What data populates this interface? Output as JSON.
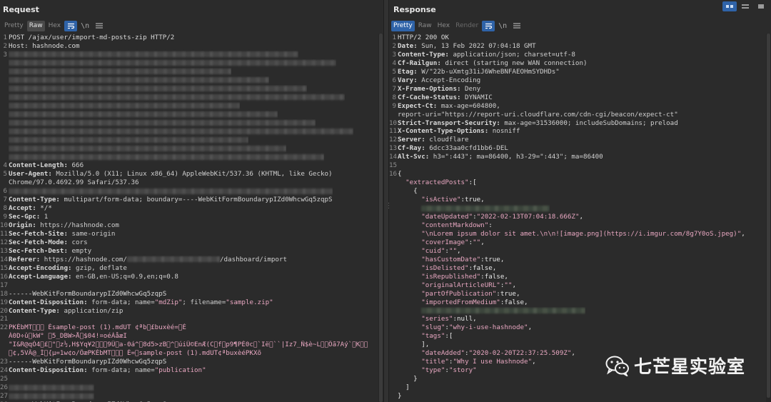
{
  "request": {
    "title": "Request",
    "tabs": [
      "Pretty",
      "Raw",
      "Hex"
    ],
    "active_tab": "Raw",
    "icons": [
      "wrap-icon",
      "newline-icon",
      "menu-icon"
    ],
    "lines": [
      {
        "n": "1",
        "parts": [
          {
            "t": "POST /ajax/user/import-md-posts-zip HTTP/2",
            "c": "txt"
          }
        ]
      },
      {
        "n": "2",
        "parts": [
          {
            "t": "Host: hashnode.com",
            "c": "txt"
          }
        ]
      },
      {
        "n": "3",
        "blur": true
      },
      {
        "n": "",
        "blur": true
      },
      {
        "n": "",
        "blur": true
      },
      {
        "n": "",
        "blur": true
      },
      {
        "n": "",
        "blur": true
      },
      {
        "n": "",
        "blur": true
      },
      {
        "n": "",
        "blur": true
      },
      {
        "n": "",
        "blur": true
      },
      {
        "n": "",
        "blur": true
      },
      {
        "n": "",
        "blur": true
      },
      {
        "n": "",
        "blur": true
      },
      {
        "n": "",
        "blur": true
      },
      {
        "n": "",
        "blur": true
      },
      {
        "n": "4",
        "parts": [
          {
            "t": "Content-Length: ",
            "c": "hkey"
          },
          {
            "t": "666",
            "c": "hval"
          }
        ]
      },
      {
        "n": "5",
        "parts": [
          {
            "t": "User-Agent: ",
            "c": "hkey"
          },
          {
            "t": "Mozilla/5.0 (X11; Linux x86_64) AppleWebKit/537.36 (KHTML, like Gecko)",
            "c": "hval"
          }
        ]
      },
      {
        "n": "",
        "parts": [
          {
            "t": "Chrome/97.0.4692.99 Safari/537.36",
            "c": "hval"
          }
        ]
      },
      {
        "n": "6",
        "blur": true
      },
      {
        "n": "7",
        "parts": [
          {
            "t": "Content-Type: ",
            "c": "hkey"
          },
          {
            "t": "multipart/form-data; boundary=----WebKitFormBoundarypIZd0WhcwGq5zqpS",
            "c": "hval"
          }
        ]
      },
      {
        "n": "8",
        "parts": [
          {
            "t": "Accept: ",
            "c": "hkey"
          },
          {
            "t": "*/*",
            "c": "hval"
          }
        ]
      },
      {
        "n": "9",
        "parts": [
          {
            "t": "Sec-Gpc: ",
            "c": "hkey"
          },
          {
            "t": "1",
            "c": "hval"
          }
        ]
      },
      {
        "n": "10",
        "parts": [
          {
            "t": "Origin: ",
            "c": "hkey"
          },
          {
            "t": "https://hashnode.com",
            "c": "hval"
          }
        ]
      },
      {
        "n": "11",
        "parts": [
          {
            "t": "Sec-Fetch-Site: ",
            "c": "hkey"
          },
          {
            "t": "same-origin",
            "c": "hval"
          }
        ]
      },
      {
        "n": "12",
        "parts": [
          {
            "t": "Sec-Fetch-Mode: ",
            "c": "hkey"
          },
          {
            "t": "cors",
            "c": "hval"
          }
        ]
      },
      {
        "n": "13",
        "parts": [
          {
            "t": "Sec-Fetch-Dest: ",
            "c": "hkey"
          },
          {
            "t": "empty",
            "c": "hval"
          }
        ]
      },
      {
        "n": "14",
        "parts": [
          {
            "t": "Referer: ",
            "c": "hkey"
          },
          {
            "t": "https://hashnode.com/",
            "c": "hval"
          },
          {
            "blur": true
          },
          {
            "t": "/dashboard/import",
            "c": "hval"
          }
        ]
      },
      {
        "n": "15",
        "parts": [
          {
            "t": "Accept-Encoding: ",
            "c": "hkey"
          },
          {
            "t": "gzip, deflate",
            "c": "hval"
          }
        ]
      },
      {
        "n": "16",
        "parts": [
          {
            "t": "Accept-Language: ",
            "c": "hkey"
          },
          {
            "t": "en-GB,en-US;q=0.9,en;q=0.8",
            "c": "hval"
          }
        ]
      },
      {
        "n": "17",
        "parts": [
          {
            "t": "",
            "c": "txt"
          }
        ]
      },
      {
        "n": "18",
        "parts": [
          {
            "t": "------WebKitFormBoundarypIZd0WhcwGq5zqpS",
            "c": "txt"
          }
        ]
      },
      {
        "n": "19",
        "parts": [
          {
            "t": "Content-Disposition: ",
            "c": "hkey"
          },
          {
            "t": "form-data; name=",
            "c": "hval"
          },
          {
            "t": "\"mdZip\"",
            "c": "str"
          },
          {
            "t": "; filename=",
            "c": "hval"
          },
          {
            "t": "\"sample.zip\"",
            "c": "str"
          }
        ]
      },
      {
        "n": "20",
        "parts": [
          {
            "t": "Content-Type: ",
            "c": "hkey"
          },
          {
            "t": "application/zip",
            "c": "hval"
          }
        ]
      },
      {
        "n": "21",
        "parts": [
          {
            "t": "",
            "c": "txt"
          }
        ]
      },
      {
        "n": "22",
        "parts": [
          {
            "t": "PKÈbMT\u0000\u0000\u0000 Èsample-post (1).mdUT ¢ªb\u0000£buxèé=\u0000É",
            "c": "str"
          }
        ]
      },
      {
        "n": "",
        "parts": [
          {
            "t": "À0D÷û\u0000kW° \u00005_DBW>Å\u0000$04!¤oéÁåæI",
            "c": "str"
          }
        ]
      },
      {
        "n": "",
        "parts": [
          {
            "t": "\"I&R@qÒ4\u0000£\u0000°\u0000z½,H$Yq¥2\u0000\u0000\u00009Ü\u0000a-0á^\u00008d5>zB\u0000^\u0000úiÜ©EnÆ(C\u0000f\u0000p9¶PÈ0c\u0000`Ië\u0000``|Iz7_Ñ$è~L\u0000\u0000Öã7Aý`\u0000K\u0000\u0000",
            "c": "str"
          }
        ]
      },
      {
        "n": "",
        "parts": [
          {
            "t": "\u0000¢,5VÂ@_Ì\u0000{µ=1w¢o/ÔæPKÈbMT\u0000\u0000\u0000 È=\u0000sample-post (1).mdUT¢ªbuxèéPKXõ",
            "c": "str"
          }
        ]
      },
      {
        "n": "23",
        "parts": [
          {
            "t": "------WebKitFormBoundarypIZd0WhcwGq5zqpS",
            "c": "txt"
          }
        ]
      },
      {
        "n": "24",
        "parts": [
          {
            "t": "Content-Disposition: ",
            "c": "hkey"
          },
          {
            "t": "form-data; name=",
            "c": "hval"
          },
          {
            "t": "\"publication\"",
            "c": "str"
          }
        ]
      },
      {
        "n": "25",
        "parts": [
          {
            "t": "",
            "c": "txt"
          }
        ]
      },
      {
        "n": "26",
        "blur": true,
        "short": true
      },
      {
        "n": "27",
        "blur": true,
        "short": true
      },
      {
        "n": "28",
        "parts": [
          {
            "t": "------WebKitFormBoundarypIZd0WhcwGq5zqpS--",
            "c": "txt"
          }
        ]
      }
    ]
  },
  "response": {
    "title": "Response",
    "tabs": [
      "Pretty",
      "Raw",
      "Hex",
      "Render"
    ],
    "active_tab": "Pretty",
    "icons": [
      "wrap-icon",
      "newline-icon",
      "menu-icon"
    ],
    "lines": [
      {
        "n": "1",
        "parts": [
          {
            "t": "HTTP/2 200 OK",
            "c": "txt"
          }
        ]
      },
      {
        "n": "2",
        "parts": [
          {
            "t": "Date: ",
            "c": "hkey"
          },
          {
            "t": "Sun, 13 Feb 2022 07:04:18 GMT",
            "c": "hval"
          }
        ]
      },
      {
        "n": "3",
        "parts": [
          {
            "t": "Content-Type: ",
            "c": "hkey"
          },
          {
            "t": "application/json; charset=utf-8",
            "c": "hval"
          }
        ]
      },
      {
        "n": "4",
        "parts": [
          {
            "t": "Cf-Railgun: ",
            "c": "hkey"
          },
          {
            "t": "direct (starting new WAN connection)",
            "c": "hval"
          }
        ]
      },
      {
        "n": "5",
        "parts": [
          {
            "t": "Etag: ",
            "c": "hkey"
          },
          {
            "t": "W/\"22b-uXmtg31iJ6WheBNFAEOHmSYDHDs\"",
            "c": "hval"
          }
        ]
      },
      {
        "n": "6",
        "parts": [
          {
            "t": "Vary: ",
            "c": "hkey"
          },
          {
            "t": "Accept-Encoding",
            "c": "hval"
          }
        ]
      },
      {
        "n": "7",
        "parts": [
          {
            "t": "X-Frame-Options: ",
            "c": "hkey"
          },
          {
            "t": "Deny",
            "c": "hval"
          }
        ]
      },
      {
        "n": "8",
        "parts": [
          {
            "t": "Cf-Cache-Status: ",
            "c": "hkey"
          },
          {
            "t": "DYNAMIC",
            "c": "hval"
          }
        ]
      },
      {
        "n": "9",
        "parts": [
          {
            "t": "Expect-Ct: ",
            "c": "hkey"
          },
          {
            "t": "max-age=604800,",
            "c": "hval"
          }
        ]
      },
      {
        "n": "",
        "parts": [
          {
            "t": "report-uri=\"https://report-uri.cloudflare.com/cdn-cgi/beacon/expect-ct\"",
            "c": "hval"
          }
        ]
      },
      {
        "n": "10",
        "parts": [
          {
            "t": "Strict-Transport-Security: ",
            "c": "hkey"
          },
          {
            "t": "max-age=31536000; includeSubDomains; preload",
            "c": "hval"
          }
        ]
      },
      {
        "n": "11",
        "parts": [
          {
            "t": "X-Content-Type-Options: ",
            "c": "hkey"
          },
          {
            "t": "nosniff",
            "c": "hval"
          }
        ]
      },
      {
        "n": "12",
        "parts": [
          {
            "t": "Server: ",
            "c": "hkey"
          },
          {
            "t": "cloudflare",
            "c": "hval"
          }
        ]
      },
      {
        "n": "13",
        "parts": [
          {
            "t": "Cf-Ray: ",
            "c": "hkey"
          },
          {
            "t": "6dcc33aa0cfd1bb6-DEL",
            "c": "hval"
          }
        ]
      },
      {
        "n": "14",
        "parts": [
          {
            "t": "Alt-Svc: ",
            "c": "hkey"
          },
          {
            "t": "h3=\":443\"; ma=86400, h3-29=\":443\"; ma=86400",
            "c": "hval"
          }
        ]
      },
      {
        "n": "15",
        "parts": [
          {
            "t": "",
            "c": "txt"
          }
        ]
      },
      {
        "n": "16",
        "parts": [
          {
            "t": "{",
            "c": "kw"
          }
        ]
      },
      {
        "n": "",
        "parts": [
          {
            "t": "  \"extractedPosts\"",
            "c": "jkey"
          },
          {
            "t": ":[",
            "c": "kw"
          }
        ]
      },
      {
        "n": "",
        "parts": [
          {
            "t": "    {",
            "c": "kw"
          }
        ]
      },
      {
        "n": "",
        "parts": [
          {
            "t": "      \"isActive\"",
            "c": "jkey"
          },
          {
            "t": ":true,",
            "c": "kw"
          }
        ]
      },
      {
        "n": "",
        "parts": [
          {
            "t": "      ",
            "c": "kw"
          },
          {
            "blur": true,
            "g": true
          }
        ]
      },
      {
        "n": "",
        "parts": [
          {
            "t": "      \"dateUpdated\"",
            "c": "jkey"
          },
          {
            "t": ":",
            "c": "kw"
          },
          {
            "t": "\"2022-02-13T07:04:18.666Z\"",
            "c": "jval"
          },
          {
            "t": ",",
            "c": "kw"
          }
        ]
      },
      {
        "n": "",
        "parts": [
          {
            "t": "      \"contentMarkdown\"",
            "c": "jkey"
          },
          {
            "t": ":",
            "c": "kw"
          }
        ]
      },
      {
        "n": "",
        "parts": [
          {
            "t": "      \"\\nLorem ipsum dolor sit amet.\\n\\n![image.png](https://i.imgur.com/8g7Y0oS.jpeg)\"",
            "c": "jval"
          },
          {
            "t": ",",
            "c": "kw"
          }
        ]
      },
      {
        "n": "",
        "parts": [
          {
            "t": "      \"coverImage\"",
            "c": "jkey"
          },
          {
            "t": ":",
            "c": "kw"
          },
          {
            "t": "\"\"",
            "c": "jval"
          },
          {
            "t": ",",
            "c": "kw"
          }
        ]
      },
      {
        "n": "",
        "parts": [
          {
            "t": "      \"cuid\"",
            "c": "jkey"
          },
          {
            "t": ":",
            "c": "kw"
          },
          {
            "t": "\"\"",
            "c": "jval"
          },
          {
            "t": ",",
            "c": "kw"
          }
        ]
      },
      {
        "n": "",
        "parts": [
          {
            "t": "      \"hasCustomDate\"",
            "c": "jkey"
          },
          {
            "t": ":true,",
            "c": "kw"
          }
        ]
      },
      {
        "n": "",
        "parts": [
          {
            "t": "      \"isDelisted\"",
            "c": "jkey"
          },
          {
            "t": ":false,",
            "c": "kw"
          }
        ]
      },
      {
        "n": "",
        "parts": [
          {
            "t": "      \"isRepublished\"",
            "c": "jkey"
          },
          {
            "t": ":false,",
            "c": "kw"
          }
        ]
      },
      {
        "n": "",
        "parts": [
          {
            "t": "      \"originalArticleURL\"",
            "c": "jkey"
          },
          {
            "t": ":",
            "c": "kw"
          },
          {
            "t": "\"\"",
            "c": "jval"
          },
          {
            "t": ",",
            "c": "kw"
          }
        ]
      },
      {
        "n": "",
        "parts": [
          {
            "t": "      \"partOfPublication\"",
            "c": "jkey"
          },
          {
            "t": ":true,",
            "c": "kw"
          }
        ]
      },
      {
        "n": "",
        "parts": [
          {
            "t": "      \"importedFromMedium\"",
            "c": "jkey"
          },
          {
            "t": ":false,",
            "c": "kw"
          }
        ]
      },
      {
        "n": "",
        "parts": [
          {
            "t": "      ",
            "c": "kw"
          },
          {
            "blur": true,
            "g": true,
            "wide": true
          }
        ]
      },
      {
        "n": "",
        "parts": [
          {
            "t": "      \"series\"",
            "c": "jkey"
          },
          {
            "t": ":null,",
            "c": "kw"
          }
        ]
      },
      {
        "n": "",
        "parts": [
          {
            "t": "      \"slug\"",
            "c": "jkey"
          },
          {
            "t": ":",
            "c": "kw"
          },
          {
            "t": "\"why-i-use-hashnode\"",
            "c": "jval"
          },
          {
            "t": ",",
            "c": "kw"
          }
        ]
      },
      {
        "n": "",
        "parts": [
          {
            "t": "      \"tags\"",
            "c": "jkey"
          },
          {
            "t": ":[",
            "c": "kw"
          }
        ]
      },
      {
        "n": "",
        "parts": [
          {
            "t": "      ],",
            "c": "kw"
          }
        ]
      },
      {
        "n": "",
        "parts": [
          {
            "t": "      \"dateAdded\"",
            "c": "jkey"
          },
          {
            "t": ":",
            "c": "kw"
          },
          {
            "t": "\"2020-02-20T22:37:25.509Z\"",
            "c": "jval"
          },
          {
            "t": ",",
            "c": "kw"
          }
        ]
      },
      {
        "n": "",
        "parts": [
          {
            "t": "      \"title\"",
            "c": "jkey"
          },
          {
            "t": ":",
            "c": "kw"
          },
          {
            "t": "\"Why I use Hashnode\"",
            "c": "jval"
          },
          {
            "t": ",",
            "c": "kw"
          }
        ]
      },
      {
        "n": "",
        "parts": [
          {
            "t": "      \"type\"",
            "c": "jkey"
          },
          {
            "t": ":",
            "c": "kw"
          },
          {
            "t": "\"story\"",
            "c": "jval"
          }
        ]
      },
      {
        "n": "",
        "parts": [
          {
            "t": "    }",
            "c": "kw"
          }
        ]
      },
      {
        "n": "",
        "parts": [
          {
            "t": "  ]",
            "c": "kw"
          }
        ]
      },
      {
        "n": "",
        "parts": [
          {
            "t": "}",
            "c": "kw"
          }
        ]
      }
    ]
  },
  "watermark": {
    "text": "七芒星实验室",
    "icon": "wechat-icon"
  },
  "colors": {
    "accent": "#2f63a8",
    "string": "#e8a7c1",
    "background": "#2b2b2b"
  }
}
